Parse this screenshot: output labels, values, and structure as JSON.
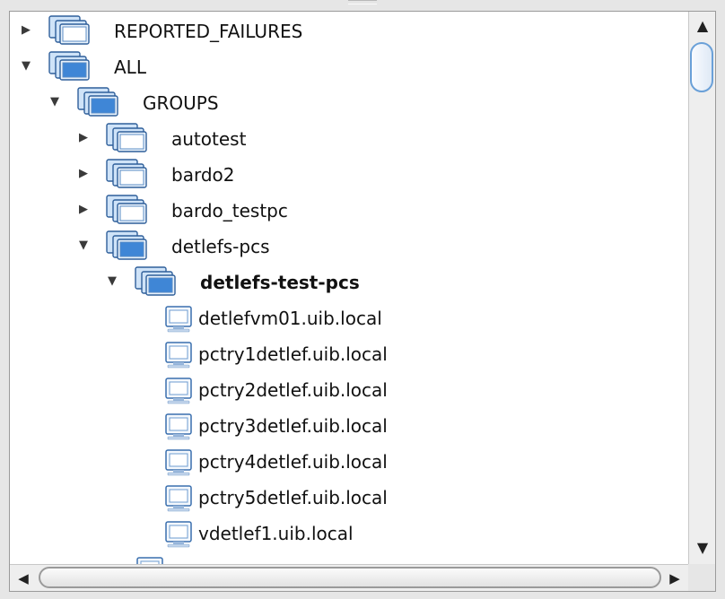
{
  "tree": {
    "nodes": [
      {
        "label": "REPORTED_FAILURES",
        "level": 0,
        "kind": "group",
        "expanded": false,
        "hasToggle": true,
        "bold": false
      },
      {
        "label": "ALL",
        "level": 0,
        "kind": "group",
        "expanded": true,
        "hasToggle": true,
        "bold": false
      },
      {
        "label": "GROUPS",
        "level": 1,
        "kind": "group",
        "expanded": true,
        "hasToggle": true,
        "bold": false
      },
      {
        "label": "autotest",
        "level": 2,
        "kind": "group",
        "expanded": false,
        "hasToggle": true,
        "bold": false
      },
      {
        "label": "bardo2",
        "level": 2,
        "kind": "group",
        "expanded": false,
        "hasToggle": true,
        "bold": false
      },
      {
        "label": "bardo_testpc",
        "level": 2,
        "kind": "group",
        "expanded": false,
        "hasToggle": true,
        "bold": false
      },
      {
        "label": "detlefs-pcs",
        "level": 2,
        "kind": "group",
        "expanded": true,
        "hasToggle": true,
        "bold": false
      },
      {
        "label": "detlefs-test-pcs",
        "level": 3,
        "kind": "group",
        "expanded": true,
        "hasToggle": true,
        "bold": true
      },
      {
        "label": "detlefvm01.uib.local",
        "level": 4,
        "kind": "client",
        "hasToggle": false,
        "bold": false
      },
      {
        "label": "pctry1detlef.uib.local",
        "level": 4,
        "kind": "client",
        "hasToggle": false,
        "bold": false
      },
      {
        "label": "pctry2detlef.uib.local",
        "level": 4,
        "kind": "client",
        "hasToggle": false,
        "bold": false
      },
      {
        "label": "pctry3detlef.uib.local",
        "level": 4,
        "kind": "client",
        "hasToggle": false,
        "bold": false
      },
      {
        "label": "pctry4detlef.uib.local",
        "level": 4,
        "kind": "client",
        "hasToggle": false,
        "bold": false
      },
      {
        "label": "pctry5detlef.uib.local",
        "level": 4,
        "kind": "client",
        "hasToggle": false,
        "bold": false
      },
      {
        "label": "vdetlef1.uib.local",
        "level": 4,
        "kind": "client",
        "hasToggle": false,
        "bold": false
      },
      {
        "label": "",
        "level": 3,
        "kind": "client",
        "hasToggle": false,
        "bold": false
      }
    ]
  },
  "scrollbars": {
    "vertical": {
      "up_icon": "arrow-up-icon",
      "down_icon": "arrow-down-icon"
    },
    "horizontal": {
      "left_icon": "arrow-left-icon",
      "right_icon": "arrow-right-icon"
    }
  },
  "colors": {
    "icon_blue": "#3f86d6",
    "icon_blue_light": "#cfe3f8",
    "selection_border": "#6aa0d8"
  }
}
